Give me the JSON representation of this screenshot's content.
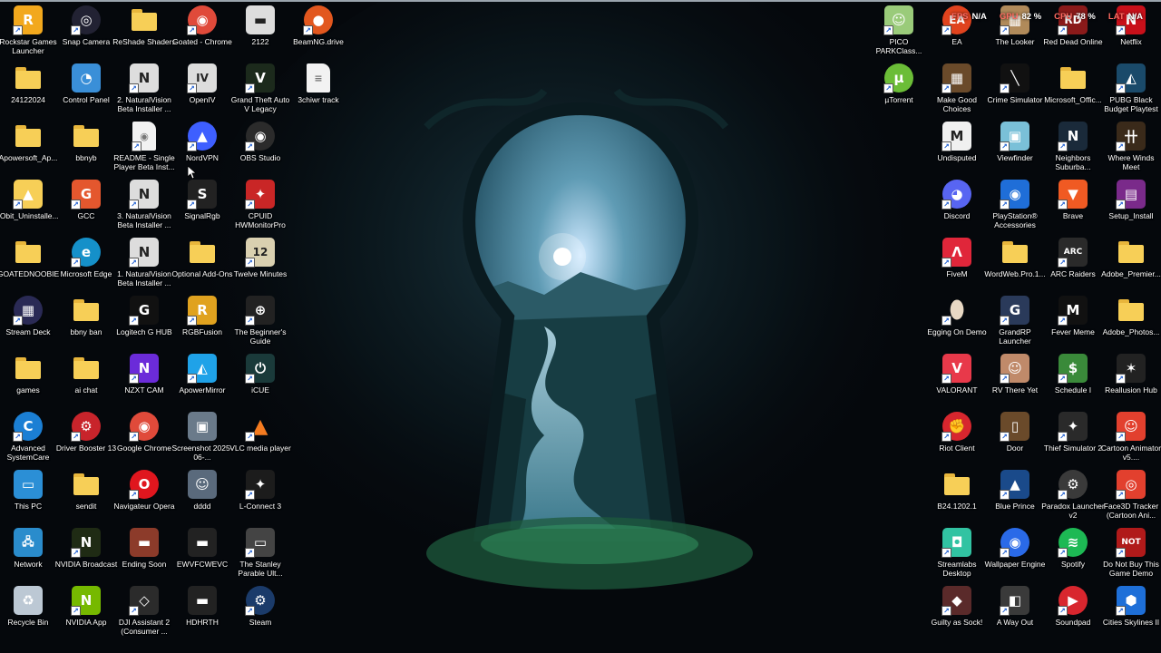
{
  "overlay": [
    {
      "key": "FPS",
      "value": "N/A"
    },
    {
      "key": "GPU",
      "value": "82 %"
    },
    {
      "key": "CPU",
      "value": "78 %"
    },
    {
      "key": "LAT",
      "value": "N/A"
    }
  ],
  "colors": {
    "desktop_bg": "#05080c",
    "moon_glow": "#cfe9ff",
    "overlay_key": "#ff6b62"
  },
  "left_icons": [
    {
      "label": "Rockstar Games Launcher",
      "icon": "rockstar-icon",
      "bg": "#f2a81d",
      "glyph": "R",
      "shortcut": true
    },
    {
      "label": "24122024",
      "icon": "folder-icon",
      "folder": true
    },
    {
      "label": "Apowersoft_Ap...",
      "icon": "folder-icon",
      "folder": true
    },
    {
      "label": "IObit_Uninstalle...",
      "icon": "iobit-icon",
      "bg": "#f7cf57",
      "glyph": "▲",
      "shortcut": true
    },
    {
      "label": "GOATEDNOOBIE",
      "icon": "folder-icon",
      "folder": true
    },
    {
      "label": "Stream Deck",
      "icon": "stream-deck-icon",
      "bg": "#2a2a55",
      "glyph": "▦",
      "shortcut": true,
      "round": true
    },
    {
      "label": "games",
      "icon": "folder-icon",
      "folder": true
    },
    {
      "label": "Advanced SystemCare",
      "icon": "advanced-systemcare-icon",
      "bg": "#1b7fd4",
      "glyph": "C",
      "shortcut": true,
      "round": true
    },
    {
      "label": "This PC",
      "icon": "this-pc-icon",
      "bg": "#2b8fd6",
      "glyph": "▭"
    },
    {
      "label": "Network",
      "icon": "network-icon",
      "bg": "#2a8ccc",
      "glyph": "🖧"
    },
    {
      "label": "Recycle Bin",
      "icon": "recycle-bin-icon",
      "bg": "#bcc8d4",
      "glyph": "♻"
    },
    {
      "label": "Snap Camera",
      "icon": "snap-camera-icon",
      "bg": "#223",
      "glyph": "◎",
      "shortcut": true,
      "round": true
    },
    {
      "label": "Control Panel",
      "icon": "control-panel-icon",
      "bg": "#3a8fd8",
      "glyph": "◔"
    },
    {
      "label": "bbnyb",
      "icon": "folder-icon",
      "folder": true
    },
    {
      "label": "GCC",
      "icon": "gcc-icon",
      "bg": "#e4572e",
      "glyph": "G",
      "shortcut": true
    },
    {
      "label": "Microsoft Edge",
      "icon": "edge-icon",
      "bg": "#1590c9",
      "glyph": "e",
      "shortcut": true,
      "round": true
    },
    {
      "label": "bbny ban",
      "icon": "folder-icon",
      "folder": true
    },
    {
      "label": "ai chat",
      "icon": "folder-icon",
      "folder": true
    },
    {
      "label": "Driver Booster 13",
      "icon": "driver-booster-icon",
      "bg": "#c8242b",
      "glyph": "⚙",
      "shortcut": true,
      "round": true
    },
    {
      "label": "sendit",
      "icon": "folder-icon",
      "folder": true
    },
    {
      "label": "NVIDIA Broadcast",
      "icon": "nvidia-broadcast-icon",
      "bg": "#1f2b14",
      "glyph": "N",
      "shortcut": true
    },
    {
      "label": "NVIDIA App",
      "icon": "nvidia-app-icon",
      "bg": "#76b900",
      "glyph": "N",
      "shortcut": true
    },
    {
      "label": "ReShade Shaders",
      "icon": "folder-icon",
      "folder": true
    },
    {
      "label": "2. NaturalVision Beta Installer ...",
      "icon": "naturalvision-icon",
      "bg": "#ddd",
      "glyph": "N",
      "shortcut": true,
      "dark": true
    },
    {
      "label": "README - Single Player Beta Inst...",
      "icon": "chrome-doc-icon",
      "doc": true,
      "glyph": "◉",
      "shortcut": true
    },
    {
      "label": "3. NaturalVision Beta Installer ...",
      "icon": "naturalvision-icon",
      "bg": "#ddd",
      "glyph": "N",
      "shortcut": true,
      "dark": true
    },
    {
      "label": "1. NaturalVision Beta Installer ...",
      "icon": "naturalvision-icon",
      "bg": "#ddd",
      "glyph": "N",
      "shortcut": true,
      "dark": true
    },
    {
      "label": "Logitech G HUB",
      "icon": "logitech-icon",
      "bg": "#111",
      "glyph": "G",
      "shortcut": true
    },
    {
      "label": "NZXT CAM",
      "icon": "nzxt-cam-icon",
      "bg": "#6b2bd9",
      "glyph": "N",
      "shortcut": true
    },
    {
      "label": "Google Chrome",
      "icon": "chrome-icon",
      "bg": "#e04a3a",
      "glyph": "◉",
      "shortcut": true,
      "round": true
    },
    {
      "label": "Navigateur Opera",
      "icon": "opera-icon",
      "bg": "#e0161e",
      "glyph": "O",
      "shortcut": true,
      "round": true
    },
    {
      "label": "Ending Soon",
      "icon": "image-file-icon",
      "bg": "#8c3b2a",
      "glyph": "▬"
    },
    {
      "label": "DJI Assistant 2 (Consumer ...",
      "icon": "dji-icon",
      "bg": "#2b2b2b",
      "glyph": "◇",
      "shortcut": true
    },
    {
      "label": "Goated - Chrome",
      "icon": "chrome-profile-icon",
      "bg": "#e04a3a",
      "glyph": "◉",
      "shortcut": true,
      "round": true
    },
    {
      "label": "OpenIV",
      "icon": "openiv-icon",
      "bg": "#ddd",
      "glyph": "IV",
      "shortcut": true,
      "dark": true
    },
    {
      "label": "NordVPN",
      "icon": "nordvpn-icon",
      "bg": "#3e5fff",
      "glyph": "▲",
      "shortcut": true,
      "round": true
    },
    {
      "label": "SignalRgb",
      "icon": "signalrgb-icon",
      "bg": "#222",
      "glyph": "S",
      "shortcut": true
    },
    {
      "label": "Optional Add-Ons",
      "icon": "folder-icon",
      "folder": true
    },
    {
      "label": "RGBFusion",
      "icon": "rgbfusion-icon",
      "bg": "#e0a21f",
      "glyph": "R",
      "shortcut": true
    },
    {
      "label": "ApowerMirror",
      "icon": "apowermirror-icon",
      "bg": "#1fa2e8",
      "glyph": "◭",
      "shortcut": true
    },
    {
      "label": "Screenshot 2025-06-...",
      "icon": "image-file-icon",
      "bg": "#6a7a8a",
      "glyph": "▣"
    },
    {
      "label": "dddd",
      "icon": "image-file-icon",
      "bg": "#5a6a7c",
      "glyph": "☺"
    },
    {
      "label": "EWVFCWEVC",
      "icon": "image-file-icon",
      "bg": "#222",
      "glyph": "▬"
    },
    {
      "label": "HDHRTH",
      "icon": "image-file-icon",
      "bg": "#222",
      "glyph": "▬"
    },
    {
      "label": "2122",
      "icon": "image-file-icon",
      "bg": "#ddd",
      "glyph": "▬",
      "dark": true
    },
    {
      "label": "Grand Theft Auto V Legacy",
      "icon": "gta-v-icon",
      "bg": "#1c2a1c",
      "glyph": "V",
      "shortcut": true
    },
    {
      "label": "OBS Studio",
      "icon": "obs-icon",
      "bg": "#2b2b2b",
      "glyph": "◉",
      "shortcut": true,
      "round": true
    },
    {
      "label": "CPUID HWMonitorPro",
      "icon": "hwmonitor-icon",
      "bg": "#c92626",
      "glyph": "✦",
      "shortcut": true
    },
    {
      "label": "Twelve Minutes",
      "icon": "twelve-minutes-icon",
      "bg": "#d9d0b0",
      "glyph": "12",
      "shortcut": true,
      "dark": true
    },
    {
      "label": "The Beginner's Guide",
      "icon": "beginners-guide-icon",
      "bg": "#222",
      "glyph": "⊕",
      "shortcut": true
    },
    {
      "label": "iCUE",
      "icon": "icue-icon",
      "bg": "#1a3a3a",
      "glyph": "⏻",
      "shortcut": true
    },
    {
      "label": "VLC media player",
      "icon": "vlc-icon",
      "bg": "transparent",
      "glyph": "▲",
      "shortcut": true,
      "orange": true
    },
    {
      "label": "L-Connect 3",
      "icon": "lconnect-icon",
      "bg": "#1c1c1c",
      "glyph": "✦",
      "shortcut": true
    },
    {
      "label": "The Stanley Parable Ult...",
      "icon": "stanley-parable-icon",
      "bg": "#444",
      "glyph": "▭",
      "shortcut": true
    },
    {
      "label": "Steam",
      "icon": "steam-icon",
      "bg": "#1b3b6a",
      "glyph": "⚙",
      "shortcut": true,
      "round": true
    },
    {
      "label": "BeamNG.drive",
      "icon": "beamng-icon",
      "bg": "#e2571e",
      "glyph": "●",
      "shortcut": true,
      "round": true
    },
    {
      "label": "3chiwr track",
      "icon": "text-file-icon",
      "doc": true,
      "glyph": "≡"
    }
  ],
  "right_icons": [
    {
      "label": "PICO PARKClass...",
      "icon": "pico-park-icon",
      "bg": "#9acb7a",
      "glyph": "☺",
      "shortcut": true
    },
    {
      "label": "µTorrent",
      "icon": "utorrent-icon",
      "bg": "#6bbd37",
      "glyph": "µ",
      "shortcut": true,
      "round": true
    },
    {
      "label": "EA",
      "icon": "ea-icon",
      "bg": "#e0431e",
      "glyph": "EA",
      "shortcut": true,
      "round": true
    },
    {
      "label": "Make Good Choices",
      "icon": "make-good-choices-icon",
      "bg": "#6a4a2a",
      "glyph": "▦",
      "shortcut": true
    },
    {
      "label": "Undisputed",
      "icon": "undisputed-icon",
      "bg": "#f0f0f0",
      "glyph": "M",
      "shortcut": true,
      "dark": true
    },
    {
      "label": "Discord",
      "icon": "discord-icon",
      "bg": "#5865f2",
      "glyph": "◕",
      "shortcut": true,
      "round": true
    },
    {
      "label": "FiveM",
      "icon": "fivem-icon",
      "bg": "#e0263a",
      "glyph": "Λ",
      "shortcut": true
    },
    {
      "label": "Egging On Demo",
      "icon": "egging-on-icon",
      "bg": "transparent",
      "glyph": "⬮",
      "shortcut": true,
      "egg": true
    },
    {
      "label": "VALORANT",
      "icon": "valorant-icon",
      "bg": "#e8394a",
      "glyph": "V",
      "shortcut": true
    },
    {
      "label": "Riot Client",
      "icon": "riot-client-icon",
      "bg": "#d7262e",
      "glyph": "✊",
      "shortcut": true,
      "round": true
    },
    {
      "label": "B24.1202.1",
      "icon": "folder-icon",
      "folder": true
    },
    {
      "label": "Streamlabs Desktop",
      "icon": "streamlabs-icon",
      "bg": "#31c3a2",
      "glyph": "◘",
      "shortcut": true
    },
    {
      "label": "Guilty as Sock!",
      "icon": "guilty-as-sock-icon",
      "bg": "#5a2a2a",
      "glyph": "◆",
      "shortcut": true
    },
    {
      "label": "The Looker",
      "icon": "the-looker-icon",
      "bg": "#b08a5a",
      "glyph": "▦",
      "shortcut": true
    },
    {
      "label": "Crime Simulator",
      "icon": "crime-simulator-icon",
      "bg": "#111",
      "glyph": "╲",
      "shortcut": true
    },
    {
      "label": "Viewfinder",
      "icon": "viewfinder-icon",
      "bg": "#7ac0d8",
      "glyph": "▣",
      "shortcut": true
    },
    {
      "label": "PlayStation® Accessories",
      "icon": "playstation-icon",
      "bg": "#1f6ed8",
      "glyph": "◉",
      "shortcut": true
    },
    {
      "label": "WordWeb.Pro.1...",
      "icon": "folder-icon",
      "folder": true
    },
    {
      "label": "GrandRP Launcher",
      "icon": "grandrp-icon",
      "bg": "#2a3a5a",
      "glyph": "G",
      "shortcut": true
    },
    {
      "label": "RV There Yet",
      "icon": "rv-there-yet-icon",
      "bg": "#c08a6a",
      "glyph": "☺",
      "shortcut": true
    },
    {
      "label": "Door",
      "icon": "door-icon",
      "bg": "#6a4a2a",
      "glyph": "▯",
      "shortcut": true
    },
    {
      "label": "Blue Prince",
      "icon": "blue-prince-icon",
      "bg": "#1a4a8a",
      "glyph": "▲",
      "shortcut": true
    },
    {
      "label": "Wallpaper Engine",
      "icon": "wallpaper-engine-icon",
      "bg": "#2a6ae8",
      "glyph": "◉",
      "shortcut": true,
      "round": true
    },
    {
      "label": "A Way Out",
      "icon": "a-way-out-icon",
      "bg": "#3a3a3a",
      "glyph": "◧",
      "shortcut": true
    },
    {
      "label": "Red Dead Online",
      "icon": "red-dead-online-icon",
      "bg": "#8a1a1a",
      "glyph": "RD",
      "shortcut": true
    },
    {
      "label": "Microsoft_Offic...",
      "icon": "folder-icon",
      "folder": true
    },
    {
      "label": "Neighbors Suburba...",
      "icon": "neighbors-icon",
      "bg": "#1a2a3a",
      "glyph": "N",
      "shortcut": true
    },
    {
      "label": "Brave",
      "icon": "brave-icon",
      "bg": "#f05a23",
      "glyph": "▼",
      "shortcut": true
    },
    {
      "label": "ARC Raiders",
      "icon": "arc-raiders-icon",
      "bg": "#2a2a2a",
      "glyph": "ARC",
      "shortcut": true
    },
    {
      "label": "Fever Meme",
      "icon": "fever-meme-icon",
      "bg": "#111",
      "glyph": "M",
      "shortcut": true
    },
    {
      "label": "Schedule I",
      "icon": "schedule-i-icon",
      "bg": "#3a8a3a",
      "glyph": "$",
      "shortcut": true
    },
    {
      "label": "Thief Simulator 2",
      "icon": "thief-simulator-icon",
      "bg": "#2a2a2a",
      "glyph": "✦",
      "shortcut": true
    },
    {
      "label": "Paradox Launcher v2",
      "icon": "paradox-launcher-icon",
      "bg": "#3a3a3a",
      "glyph": "⚙",
      "shortcut": true,
      "round": true
    },
    {
      "label": "Spotify",
      "icon": "spotify-icon",
      "bg": "#1db954",
      "glyph": "≋",
      "shortcut": true,
      "round": true
    },
    {
      "label": "Soundpad",
      "icon": "soundpad-icon",
      "bg": "#d8262e",
      "glyph": "▶",
      "shortcut": true,
      "round": true
    },
    {
      "label": "Netflix",
      "icon": "netflix-icon",
      "bg": "#c8101a",
      "glyph": "N",
      "shortcut": true
    },
    {
      "label": "PUBG Black Budget Playtest",
      "icon": "pubg-icon",
      "bg": "#1a4a6a",
      "glyph": "◭",
      "shortcut": true
    },
    {
      "label": "Where Winds Meet",
      "icon": "where-winds-meet-icon",
      "bg": "#3a2a1a",
      "glyph": "卄",
      "shortcut": true
    },
    {
      "label": "Setup_Install",
      "icon": "winrar-icon",
      "bg": "#7a2a8a",
      "glyph": "▤",
      "shortcut": true
    },
    {
      "label": "Adobe_Premier...",
      "icon": "folder-icon",
      "folder": true
    },
    {
      "label": "Adobe_Photos...",
      "icon": "folder-icon",
      "folder": true
    },
    {
      "label": "Reallusion Hub",
      "icon": "reallusion-icon",
      "bg": "#222",
      "glyph": "✶",
      "shortcut": true
    },
    {
      "label": "Cartoon Animator v5....",
      "icon": "cartoon-animator-icon",
      "bg": "#e2402e",
      "glyph": "☺",
      "shortcut": true
    },
    {
      "label": "Face3D Tracker (Cartoon Ani...",
      "icon": "face3d-tracker-icon",
      "bg": "#e2402e",
      "glyph": "◎",
      "shortcut": true
    },
    {
      "label": "Do Not Buy This Game Demo",
      "icon": "do-not-buy-icon",
      "bg": "#b01a1a",
      "glyph": "NOT",
      "shortcut": true
    },
    {
      "label": "Cities Skylines II",
      "icon": "cities-skylines-icon",
      "bg": "#1e6fd8",
      "glyph": "⬢",
      "shortcut": true
    }
  ]
}
